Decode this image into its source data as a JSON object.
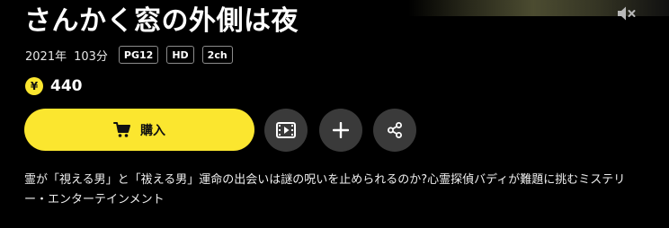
{
  "title": "さんかく窓の外側は夜",
  "meta": {
    "year": "2021年",
    "duration": "103分",
    "badges": [
      "PG12",
      "HD",
      "2ch"
    ]
  },
  "price": {
    "currency_symbol": "¥",
    "value": "440"
  },
  "actions": {
    "buy_label": "購入"
  },
  "description": "霊が「視える男」と「祓える男」運命の出会いは謎の呪いを止められるのか?心霊探偵バディが難題に挑むミステリー・エンターテインメント",
  "icons": {
    "mute": "speaker-muted-icon",
    "cart": "cart-icon",
    "trailer": "film-play-icon",
    "add": "plus-icon",
    "share": "share-icon"
  },
  "colors": {
    "accent": "#fbe62f",
    "background": "#000000",
    "circle_button": "#3a3a3a",
    "badge_border": "#8c8c8c"
  }
}
